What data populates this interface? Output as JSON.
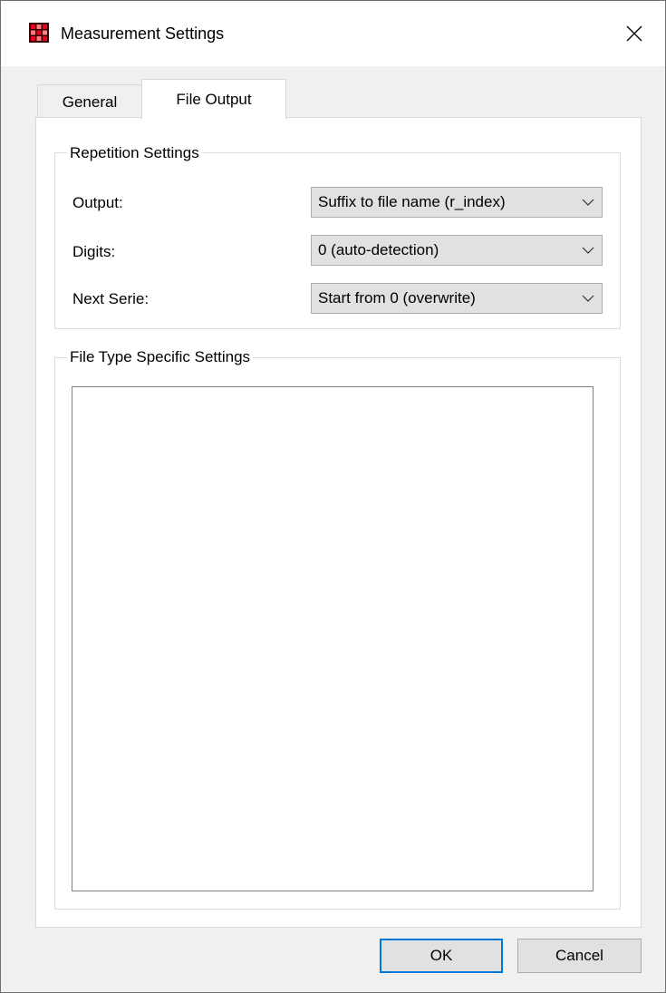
{
  "window": {
    "title": "Measurement Settings",
    "icon": "grid-app-icon",
    "close_icon": "close-icon"
  },
  "tabs": [
    {
      "label": "General",
      "selected": false
    },
    {
      "label": "File Output",
      "selected": true
    }
  ],
  "repetition": {
    "legend": "Repetition Settings",
    "rows": [
      {
        "label": "Output:",
        "value": "Suffix to file name (r_index)"
      },
      {
        "label": "Digits:",
        "value": "0 (auto-detection)"
      },
      {
        "label": "Next Serie:",
        "value": "Start from 0 (overwrite)"
      }
    ]
  },
  "file_type": {
    "legend": "File Type Specific Settings"
  },
  "buttons": {
    "ok": "OK",
    "cancel": "Cancel"
  },
  "colors": {
    "accent": "#0078d7",
    "icon_red": "#e8001f",
    "icon_dark": "#3a0000"
  }
}
